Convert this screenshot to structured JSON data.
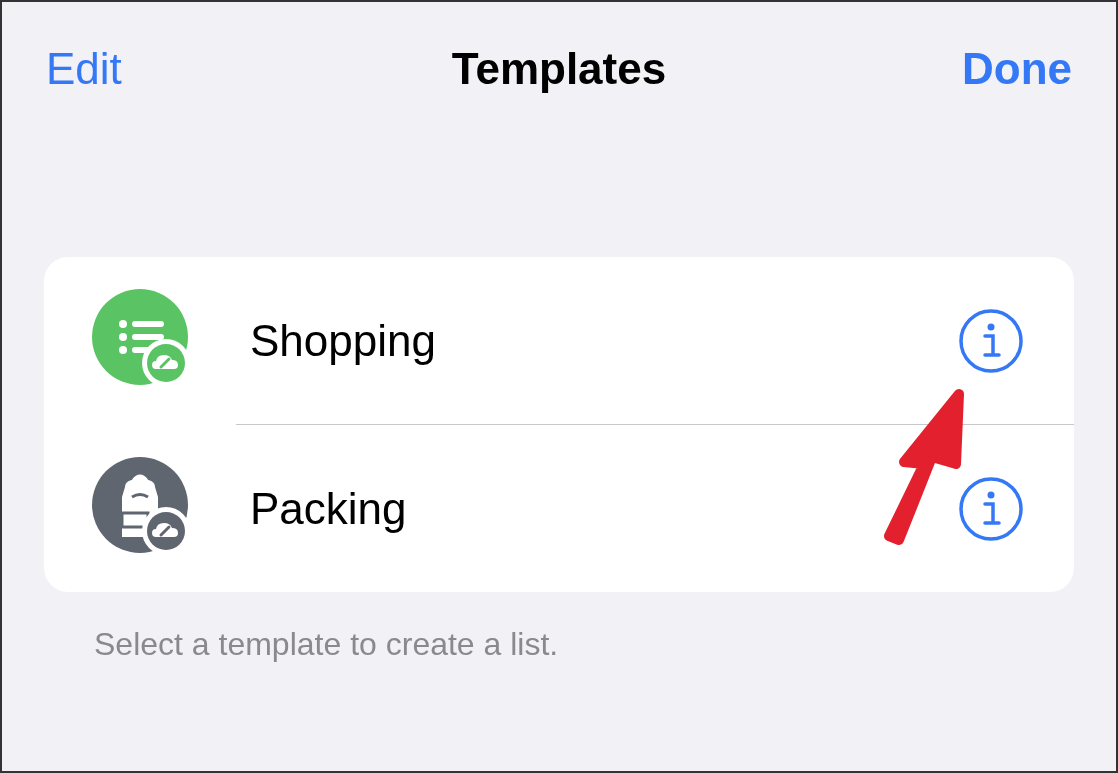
{
  "nav_bar": {
    "left_button": "Edit",
    "title": "Templates",
    "right_button": "Done"
  },
  "templates": [
    {
      "name": "Shopping",
      "kind": "list",
      "color": "#5ac465"
    },
    {
      "name": "Packing",
      "kind": "backpack",
      "color": "#5f6670"
    }
  ],
  "footer": "Select a template to create a list."
}
